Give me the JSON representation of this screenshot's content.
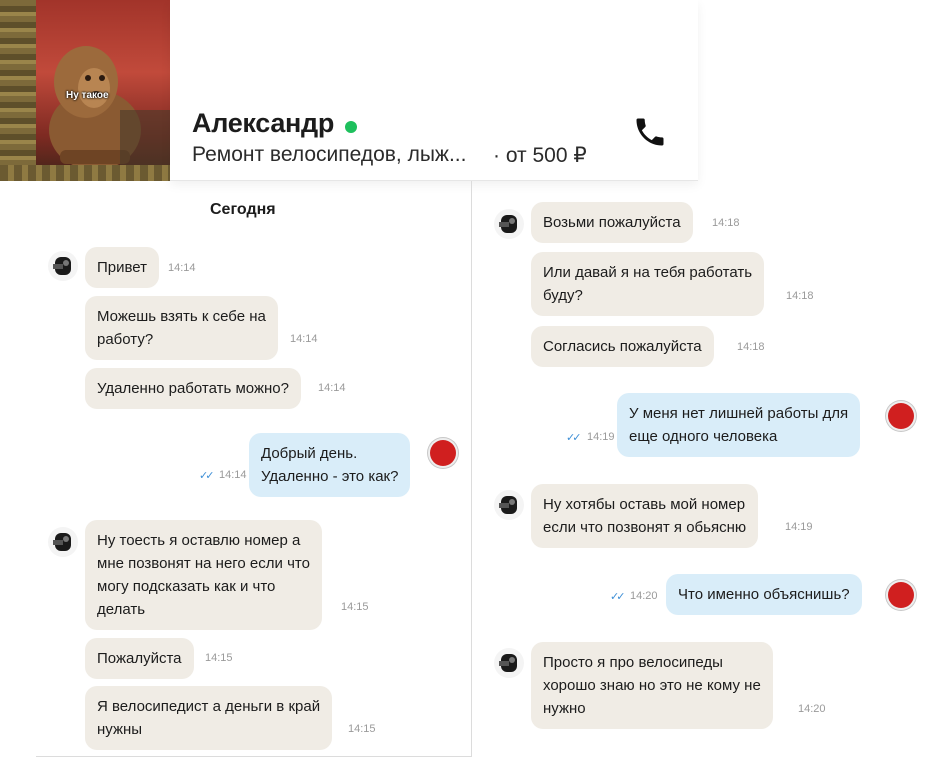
{
  "meme": {
    "caption": "Ну такое"
  },
  "header": {
    "name": "Александр",
    "subtitle": "Ремонт велосипедов, лыж...",
    "price": "· от 500 ₽"
  },
  "left": {
    "date": "Сегодня",
    "messages": [
      {
        "lines": [
          "Привет"
        ],
        "time": "14:14"
      },
      {
        "lines": [
          "Можешь взять к себе на",
          "работу?"
        ],
        "time": "14:14"
      },
      {
        "lines": [
          "Удаленно работать можно?"
        ],
        "time": "14:14"
      },
      {
        "lines": [
          "Добрый день.",
          "Удаленно - это как?"
        ],
        "time": "14:14"
      },
      {
        "lines": [
          "Ну тоесть я оставлю номер а",
          "мне позвонят на него если что",
          "могу подсказать как и что",
          "делать"
        ],
        "time": "14:15"
      },
      {
        "lines": [
          "Пожалуйста"
        ],
        "time": "14:15"
      },
      {
        "lines": [
          "Я велосипедист а деньги в край",
          "нужны"
        ],
        "time": "14:15"
      }
    ]
  },
  "right": {
    "messages": [
      {
        "lines": [
          "Возьми пожалуйста"
        ],
        "time": "14:18"
      },
      {
        "lines": [
          "Или давай я на тебя работать",
          "буду?"
        ],
        "time": "14:18"
      },
      {
        "lines": [
          "Согласись пожалуйста"
        ],
        "time": "14:18"
      },
      {
        "lines": [
          "У меня нет лишней работы для",
          "еще одного человека"
        ],
        "time": "14:19"
      },
      {
        "lines": [
          "Ну хотябы оставь мой номер",
          "если что позвонят я обьясню"
        ],
        "time": "14:19"
      },
      {
        "lines": [
          "Что именно объяснишь?"
        ],
        "time": "14:20"
      },
      {
        "lines": [
          "Просто я про велосипеды",
          "хорошо знаю но это не кому не",
          "нужно"
        ],
        "time": "14:20"
      }
    ]
  },
  "ticks": "✓✓",
  "icons": {
    "phone": "phone-icon",
    "online": "online-status-icon"
  },
  "colors": {
    "incoming": "#f0ece5",
    "outgoing": "#d9edf9",
    "online": "#1ec05d",
    "ticks": "#3e8fd6"
  }
}
